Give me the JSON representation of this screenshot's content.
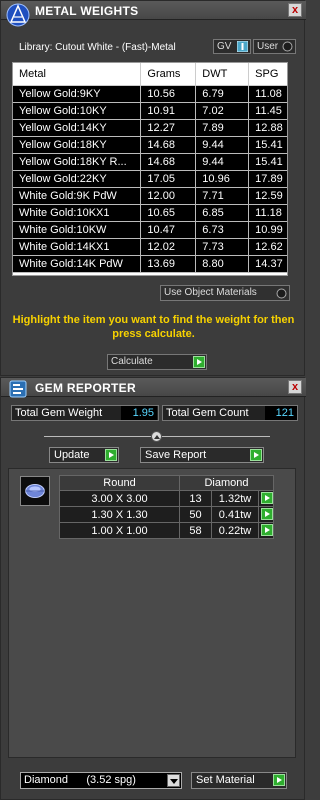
{
  "metal": {
    "title": "METAL WEIGHTS",
    "close_glyph": "x",
    "library_label": "Library: Cutout White - (Fast)-Metal",
    "gv_label": "GV",
    "user_label": "User",
    "columns": [
      "Metal",
      "Grams",
      "DWT",
      "SPG"
    ],
    "rows": [
      [
        "Yellow Gold:9KY",
        "10.56",
        "6.79",
        "11.08"
      ],
      [
        "Yellow Gold:10KY",
        "10.91",
        "7.02",
        "11.45"
      ],
      [
        "Yellow Gold:14KY",
        "12.27",
        "7.89",
        "12.88"
      ],
      [
        "Yellow Gold:18KY",
        "14.68",
        "9.44",
        "15.41"
      ],
      [
        "Yellow Gold:18KY R...",
        "14.68",
        "9.44",
        "15.41"
      ],
      [
        "Yellow Gold:22KY",
        "17.05",
        "10.96",
        "17.89"
      ],
      [
        "White Gold:9K PdW",
        "12.00",
        "7.71",
        "12.59"
      ],
      [
        "White Gold:10KX1",
        "10.65",
        "6.85",
        "11.18"
      ],
      [
        "White Gold:10KW",
        "10.47",
        "6.73",
        "10.99"
      ],
      [
        "White Gold:14KX1",
        "12.02",
        "7.73",
        "12.62"
      ],
      [
        "White Gold:14K PdW",
        "13.69",
        "8.80",
        "14.37"
      ]
    ],
    "use_object_materials": "Use Object Materials",
    "hint": "Highlight the item you want to find the weight for then press calculate.",
    "calculate_label": "Calculate"
  },
  "gem": {
    "title": "GEM REPORTER",
    "close_glyph": "x",
    "total_weight_label": "Total Gem Weight",
    "total_weight_value": "1.95",
    "total_count_label": "Total Gem Count",
    "total_count_value": "121",
    "update_label": "Update",
    "save_report_label": "Save Report",
    "shape_header": "Round",
    "type_header": "Diamond",
    "rows": [
      {
        "size": "3.00 X 3.00",
        "count": "13",
        "weight": "1.32tw"
      },
      {
        "size": "1.30 X 1.30",
        "count": "50",
        "weight": "0.41tw"
      },
      {
        "size": "1.00 X 1.00",
        "count": "58",
        "weight": "0.22tw"
      }
    ],
    "material_select": "Diamond      (3.52 spg)",
    "set_material_label": "Set Material"
  },
  "colors": {
    "accent_green": "#2fae2f",
    "hint_yellow": "#f7d200",
    "value_cyan": "#58d6ff"
  }
}
